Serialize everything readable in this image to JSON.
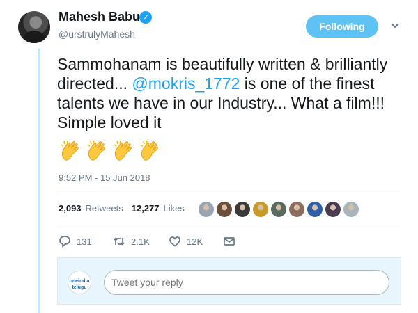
{
  "tweet": {
    "author_name": "Mahesh Babu",
    "author_handle": "@urstrulyMahesh",
    "follow_button_label": "Following",
    "text_before_mention": "Sammohanam is beautifully written & brilliantly directed... ",
    "mention": "@mokris_1772",
    "text_after_mention": " is one of the finest talents we have in our Industry... What a film!!! Simple loved it",
    "emoji": [
      "clapping-hands",
      "clapping-hands",
      "clapping-hands",
      "clapping-hands"
    ],
    "timestamp": "9:52 PM - 15 Jun 2018"
  },
  "stats": {
    "retweets_count": "2,093",
    "retweets_label": "Retweets",
    "likes_count": "12,277",
    "likes_label": "Likes",
    "liker_avatar_count": 9
  },
  "actions": {
    "replies": "131",
    "retweets": "2.1K",
    "likes": "12K"
  },
  "reply": {
    "avatar_text": "oneindia telugu",
    "placeholder": "Tweet your reply"
  },
  "colors": {
    "accent": "#1da1f2",
    "follow_button": "#5fc2f4",
    "thread_line": "#c4eaf8",
    "reply_box_bg": "#e8f5fd"
  }
}
